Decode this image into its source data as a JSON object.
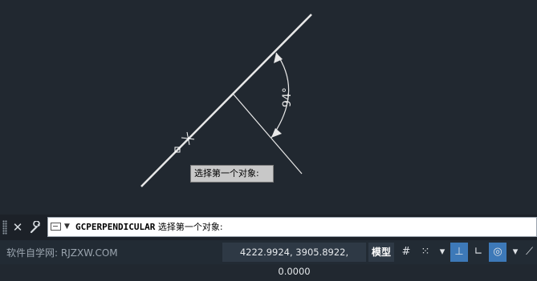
{
  "drawing": {
    "angle_label": "94°",
    "tooltip": "选择第一个对象:"
  },
  "command_line": {
    "command_name": "GCPERPENDICULAR",
    "prompt": " 选择第一个对象:"
  },
  "statusbar": {
    "watermark": "软件自学网: RJZXW.COM",
    "coordinates": "4222.9924, 3905.8922, 0.0000",
    "model_tab": "模型"
  },
  "colors": {
    "canvas_background": "#212830",
    "status_active": "#3d79b8"
  }
}
